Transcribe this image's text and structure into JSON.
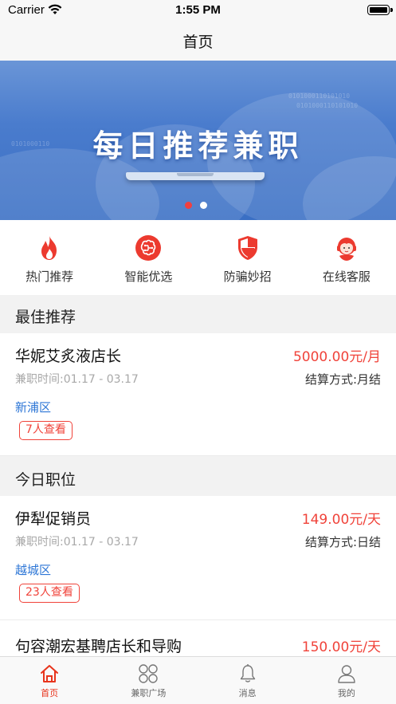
{
  "status_bar": {
    "carrier": "Carrier",
    "time": "1:55 PM"
  },
  "nav": {
    "title": "首页"
  },
  "banner": {
    "headline": "每日推荐兼职",
    "slide_count": 2,
    "active_slide": 1
  },
  "quick_menu": [
    {
      "label": "热门推荐",
      "icon": "fire-icon"
    },
    {
      "label": "智能优选",
      "icon": "brain-icon"
    },
    {
      "label": "防骗妙招",
      "icon": "shield-icon"
    },
    {
      "label": "在线客服",
      "icon": "headset-icon"
    }
  ],
  "sections": {
    "best": "最佳推荐",
    "today": "今日职位"
  },
  "best_jobs": [
    {
      "title": "华妮艾炙液店长",
      "salary": "5000.00元/月",
      "time": "兼职时间:01.17 - 03.17",
      "settle": "结算方式:月结",
      "area": "新浦区",
      "views": "7人查看"
    }
  ],
  "today_jobs": [
    {
      "title": "伊犁促销员",
      "salary": "149.00元/天",
      "time": "兼职时间:01.17 - 03.17",
      "settle": "结算方式:日结",
      "area": "越城区",
      "views": "23人查看"
    },
    {
      "title": "句容潮宏基聘店长和导购",
      "salary": "150.00元/天"
    }
  ],
  "tabs": [
    {
      "label": "首页",
      "icon": "home-icon",
      "active": true
    },
    {
      "label": "兼职广场",
      "icon": "grid-icon",
      "active": false
    },
    {
      "label": "消息",
      "icon": "bell-icon",
      "active": false
    },
    {
      "label": "我的",
      "icon": "user-icon",
      "active": false
    }
  ],
  "colors": {
    "accent": "#f0433a",
    "area_link": "#2d76d6",
    "tab_active": "#e8341c"
  }
}
